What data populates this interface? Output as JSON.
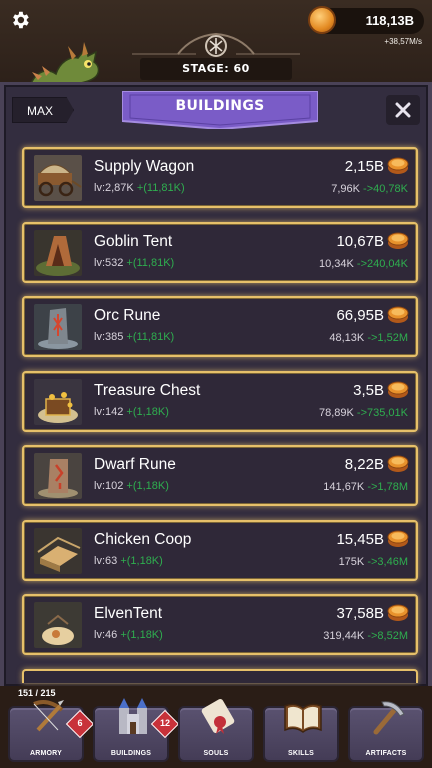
{
  "hud": {
    "settings_icon": "gear-icon",
    "gold": "118,13B",
    "gold_rate": "+38,57M/s",
    "stage": "STAGE: 60"
  },
  "panel": {
    "max_label": "MAX",
    "title": "BUILDINGS",
    "close_icon": "close-icon"
  },
  "buildings": [
    {
      "name": "Supply Wagon",
      "level": "lv:2,87K",
      "level_bonus": "+(11,81K)",
      "cost": "2,15B",
      "prod": "7,96K",
      "prod_next": "->40,78K",
      "icon": "wagon"
    },
    {
      "name": "Goblin Tent",
      "level": "lv:532",
      "level_bonus": "+(11,81K)",
      "cost": "10,67B",
      "prod": "10,34K",
      "prod_next": "->240,04K",
      "icon": "tent"
    },
    {
      "name": "Orc Rune",
      "level": "lv:385",
      "level_bonus": "+(11,81K)",
      "cost": "66,95B",
      "prod": "48,13K",
      "prod_next": "->1,52M",
      "icon": "rune"
    },
    {
      "name": "Treasure Chest",
      "level": "lv:142",
      "level_bonus": "+(1,18K)",
      "cost": "3,5B",
      "prod": "78,89K",
      "prod_next": "->735,01K",
      "icon": "chest"
    },
    {
      "name": "Dwarf Rune",
      "level": "lv:102",
      "level_bonus": "+(1,18K)",
      "cost": "8,22B",
      "prod": "141,67K",
      "prod_next": "->1,78M",
      "icon": "rune2"
    },
    {
      "name": "Chicken Coop",
      "level": "lv:63",
      "level_bonus": "+(1,18K)",
      "cost": "15,45B",
      "prod": "175K",
      "prod_next": "->3,46M",
      "icon": "coop"
    },
    {
      "name": "ElvenTent",
      "level": "lv:46",
      "level_bonus": "+(1,18K)",
      "cost": "37,58B",
      "prod": "319,44K",
      "prod_next": "->8,52M",
      "icon": "elftent"
    }
  ],
  "footer": {
    "count": "151 / 215",
    "nav": [
      {
        "label": "ARMORY",
        "badge": "6",
        "icon": "crossbow-icon"
      },
      {
        "label": "BUILDINGS",
        "badge": "12",
        "icon": "castle-icon"
      },
      {
        "label": "SOULS",
        "badge": "",
        "icon": "scroll-icon"
      },
      {
        "label": "SKILLS",
        "badge": "",
        "icon": "book-icon"
      },
      {
        "label": "ARTIFACTS",
        "badge": "",
        "icon": "pickaxe-icon"
      }
    ]
  },
  "colors": {
    "card_border": "#e6c06a",
    "bonus_green": "#2fae4f",
    "banner_purple": "#7a5cc7",
    "badge_red": "#c8323a"
  }
}
